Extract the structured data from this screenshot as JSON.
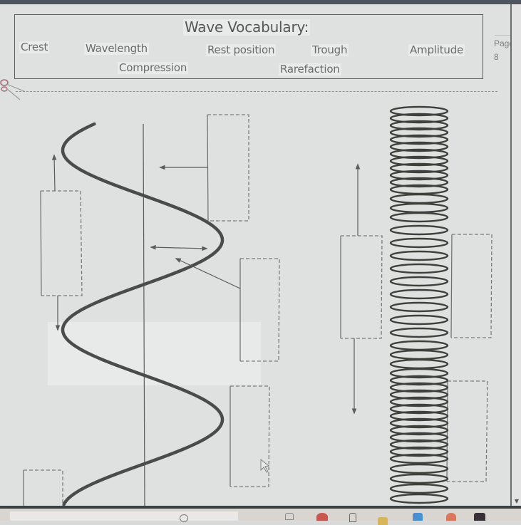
{
  "document": {
    "vocab_title": "Wave Vocabulary:",
    "vocab_words": [
      "Crest",
      "Wavelength",
      "Rest position",
      "Trough",
      "Amplitude",
      "Compression",
      "Rarefaction"
    ],
    "page_label": "Page |",
    "page_number": "8"
  },
  "diagram": {
    "transverse_wave_answer_boxes": 5,
    "longitudinal_wave_answer_boxes": 3,
    "answer_box_values": [
      "",
      "",
      "",
      "",
      "",
      "",
      "",
      ""
    ]
  },
  "colors": {
    "background": "#dfe1e0",
    "ink": "#5a5c5c",
    "wave_stroke": "#4a4c4c",
    "highlight": "#e9ebea"
  },
  "taskbar": {
    "icons": [
      "search-icon",
      "task-view-icon",
      "chrome-icon",
      "tablet-icon",
      "file-explorer-icon",
      "mail-icon",
      "app-red-icon",
      "app-dark-icon"
    ]
  }
}
